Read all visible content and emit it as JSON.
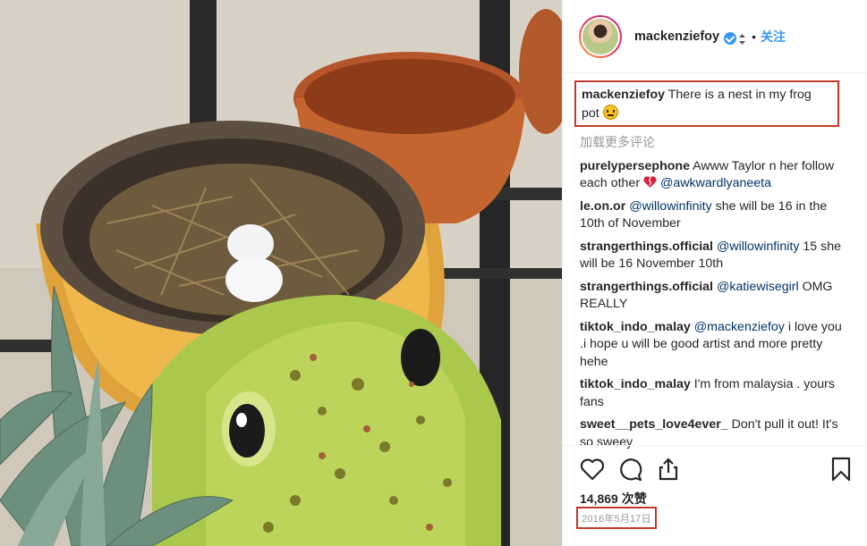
{
  "post": {
    "username": "mackenziefoy",
    "follow_label": "关注",
    "separator": "•",
    "caption_text": "There is a nest in my frog pot",
    "load_more": "加载更多评论",
    "comments": [
      {
        "user": "purelypersephone",
        "text": "Awww Taylor n her follow each other",
        "mention": "@awkwardlyaneeta"
      },
      {
        "user": "le.on.or",
        "mention": "@willowinfinity",
        "text": "she will be 16 in the 10th of November"
      },
      {
        "user": "strangerthings.official",
        "mention": "@willowinfinity",
        "text": "15 she will be 16 November 10th"
      },
      {
        "user": "strangerthings.official",
        "mention": "@katiewisegirl",
        "text": "OMG REALLY"
      },
      {
        "user": "tiktok_indo_malay",
        "mention": "@mackenziefoy",
        "text": "i love you .i hope u will be good artist and more pretty hehe"
      },
      {
        "user": "tiktok_indo_malay",
        "text": "I'm from malaysia . yours fans"
      },
      {
        "user": "sweet__pets_love4ever_",
        "text": "Don't pull it out! It's so sweey"
      }
    ],
    "likes": "14,869 次赞",
    "date": "2016年5月17日",
    "icons": [
      "heart-icon",
      "comment-icon",
      "share-icon",
      "bookmark-icon",
      "verified-badge-icon"
    ],
    "colors": {
      "link": "#3897f0",
      "mention": "#003569",
      "highlight_box": "#c0392b",
      "muted": "#999999"
    }
  }
}
